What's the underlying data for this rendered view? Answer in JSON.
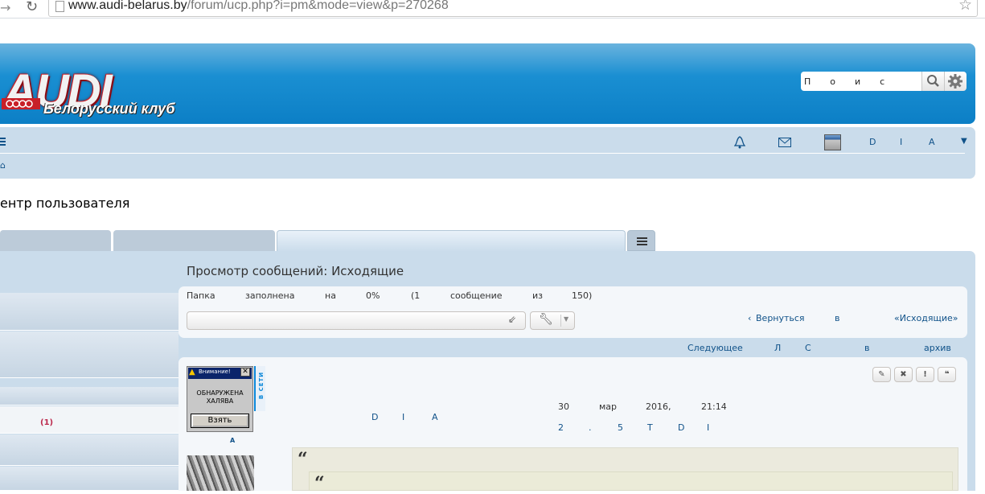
{
  "browser": {
    "url_host": "www.audi-belarus.by",
    "url_path": "/forum/ucp.php?i=pm&mode=view&p=270268"
  },
  "header": {
    "logo_text": "AUDI",
    "logo_subtitle": "Белорусский клуб",
    "search_value": "Поис"
  },
  "navbar": {
    "user_letters": [
      "D",
      "I",
      "A"
    ]
  },
  "page": {
    "title": "ентр пользователя"
  },
  "sidebar": {
    "badge": "(1)"
  },
  "pm": {
    "section_title": "Просмотр сообщений: Исходящие",
    "folder_words": [
      "Папка",
      "заполнена",
      "на",
      "0%",
      "(1",
      "сообщение",
      "из",
      "150)"
    ],
    "back_words": [
      "Вернуться",
      "в",
      "«Исходящие»"
    ],
    "next_words": [
      "Следующее",
      "Л",
      "С",
      "в",
      "архив"
    ]
  },
  "post": {
    "popup_title": "Внимание!",
    "popup_message_1": "ОБНАРУЖЕНА",
    "popup_message_2": "ХАЛЯВА",
    "popup_button": "Взять",
    "online_label": "В СЕТИ",
    "profile_name": "A",
    "author_letters": [
      "D",
      "I",
      "A"
    ],
    "date_words": [
      "30",
      "мар",
      "2016,",
      "21:14"
    ],
    "car_words": [
      "2",
      ".",
      "5",
      "T",
      "D",
      "I"
    ],
    "buttons": [
      "✎",
      "✖",
      "!",
      "❝"
    ]
  },
  "colors": {
    "header_blue": "#0c7fc6",
    "navbar_bg": "#cadceb",
    "link": "#105289",
    "logo_red": "#c82028"
  }
}
